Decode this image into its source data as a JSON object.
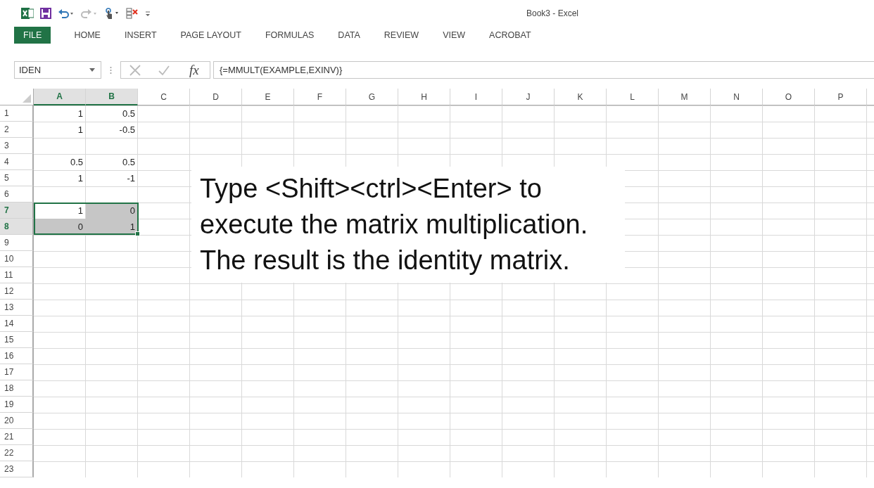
{
  "window": {
    "title": "Book3 - Excel"
  },
  "ribbon_tabs": [
    {
      "label": "FILE",
      "kind": "file",
      "selected": false
    },
    {
      "label": "HOME",
      "kind": "tab",
      "selected": false
    },
    {
      "label": "INSERT",
      "kind": "tab",
      "selected": false
    },
    {
      "label": "PAGE LAYOUT",
      "kind": "tab",
      "selected": false
    },
    {
      "label": "FORMULAS",
      "kind": "tab",
      "selected": false
    },
    {
      "label": "DATA",
      "kind": "tab",
      "selected": false
    },
    {
      "label": "REVIEW",
      "kind": "tab",
      "selected": false
    },
    {
      "label": "VIEW",
      "kind": "tab",
      "selected": false
    },
    {
      "label": "ACROBAT",
      "kind": "tab",
      "selected": false
    }
  ],
  "formula_bar": {
    "name_box": "IDEN",
    "function_label": "fx",
    "formula": "{=MMULT(EXAMPLE,EXINV)}"
  },
  "columns": [
    {
      "label": "A",
      "selected": true
    },
    {
      "label": "B",
      "selected": true
    },
    {
      "label": "C",
      "selected": false
    },
    {
      "label": "D",
      "selected": false
    },
    {
      "label": "E",
      "selected": false
    },
    {
      "label": "F",
      "selected": false
    },
    {
      "label": "G",
      "selected": false
    },
    {
      "label": "H",
      "selected": false
    },
    {
      "label": "I",
      "selected": false
    },
    {
      "label": "J",
      "selected": false
    },
    {
      "label": "K",
      "selected": false
    },
    {
      "label": "L",
      "selected": false
    },
    {
      "label": "M",
      "selected": false
    },
    {
      "label": "N",
      "selected": false
    },
    {
      "label": "O",
      "selected": false
    },
    {
      "label": "P",
      "selected": false
    }
  ],
  "rows": [
    {
      "label": "1",
      "selected": false,
      "cells": [
        {
          "value": "1",
          "selected": false
        },
        {
          "value": "0.5",
          "selected": false
        }
      ]
    },
    {
      "label": "2",
      "selected": false,
      "cells": [
        {
          "value": "1",
          "selected": false
        },
        {
          "value": "-0.5",
          "selected": false
        }
      ]
    },
    {
      "label": "3",
      "selected": false
    },
    {
      "label": "4",
      "selected": false,
      "cells": [
        {
          "value": "0.5",
          "selected": false
        },
        {
          "value": "0.5",
          "selected": false
        }
      ]
    },
    {
      "label": "5",
      "selected": false,
      "cells": [
        {
          "value": "1",
          "selected": false
        },
        {
          "value": "-1",
          "selected": false
        }
      ]
    },
    {
      "label": "6",
      "selected": false
    },
    {
      "label": "7",
      "selected": true,
      "cells": [
        {
          "value": "1",
          "selected": true,
          "active": true
        },
        {
          "value": "0",
          "selected": true,
          "active": false
        }
      ]
    },
    {
      "label": "8",
      "selected": true,
      "cells": [
        {
          "value": "0",
          "selected": true,
          "active": false
        },
        {
          "value": "1",
          "selected": true,
          "active": false
        }
      ]
    },
    {
      "label": "9",
      "selected": false
    },
    {
      "label": "10",
      "selected": false
    },
    {
      "label": "11",
      "selected": false
    },
    {
      "label": "12",
      "selected": false
    },
    {
      "label": "13",
      "selected": false
    },
    {
      "label": "14",
      "selected": false
    },
    {
      "label": "15",
      "selected": false
    },
    {
      "label": "16",
      "selected": false
    },
    {
      "label": "17",
      "selected": false
    },
    {
      "label": "18",
      "selected": false
    },
    {
      "label": "19",
      "selected": false
    },
    {
      "label": "20",
      "selected": false
    },
    {
      "label": "21",
      "selected": false
    },
    {
      "label": "22",
      "selected": false
    },
    {
      "label": "23",
      "selected": false
    }
  ],
  "note": {
    "lines": [
      "Type <Shift><ctrl><Enter> to",
      "execute the matrix multiplication.",
      "The result is the identity matrix."
    ]
  }
}
